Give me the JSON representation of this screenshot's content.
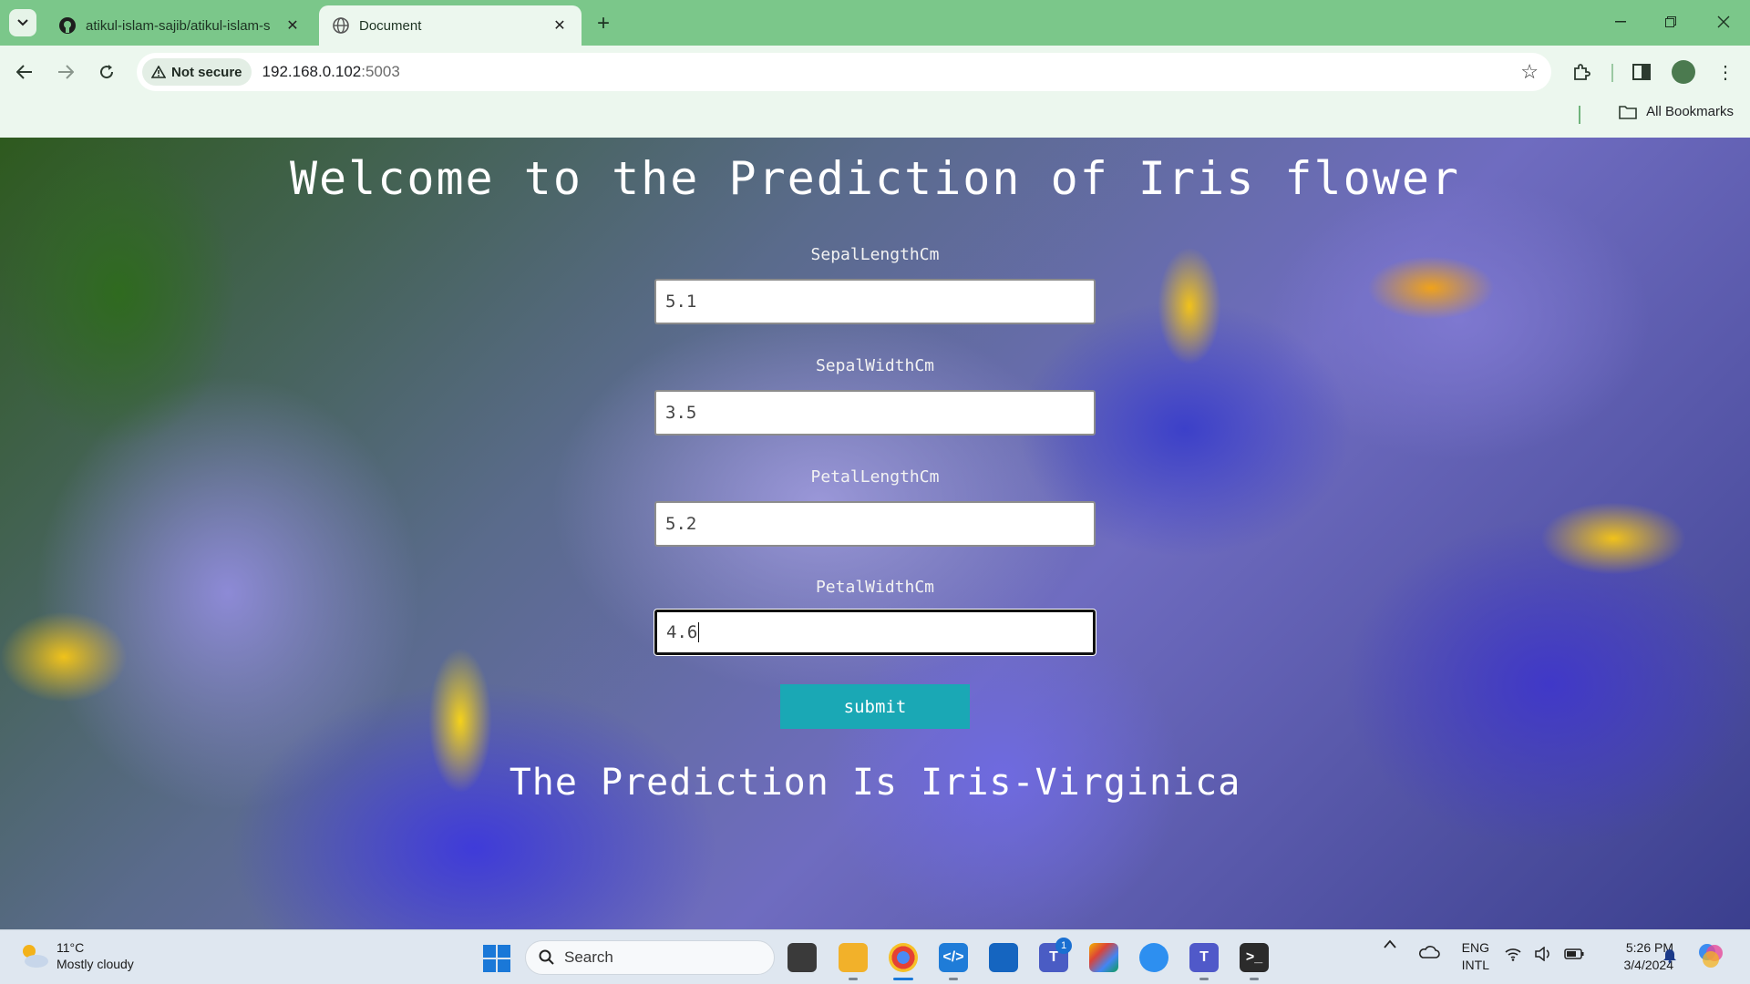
{
  "browser": {
    "tabs": [
      {
        "title": "atikul-islam-sajib/atikul-islam-s",
        "favicon": "github-icon",
        "active": false
      },
      {
        "title": "Document",
        "favicon": "globe-icon",
        "active": true
      }
    ],
    "security_label": "Not secure",
    "url_host": "192.168.0.102",
    "url_port": ":5003",
    "bookmarks_label": "All Bookmarks"
  },
  "page": {
    "title": "Welcome to the Prediction of Iris flower",
    "fields": [
      {
        "label": "SepalLengthCm",
        "value": "5.1"
      },
      {
        "label": "SepalWidthCm",
        "value": "3.5"
      },
      {
        "label": "PetalLengthCm",
        "value": "5.2"
      },
      {
        "label": "PetalWidthCm",
        "value": "4.6"
      }
    ],
    "submit_label": "submit",
    "result": "The Prediction Is Iris-Virginica"
  },
  "taskbar": {
    "weather_temp": "11°C",
    "weather_desc": "Mostly cloudy",
    "search_placeholder": "Search",
    "lang_top": "ENG",
    "lang_bottom": "INTL",
    "time": "5:26 PM",
    "date": "3/4/2024",
    "teams_badge": "1"
  },
  "colors": {
    "tabstrip": "#7bc78a",
    "toolbar": "#ecf7ee",
    "submit": "#1aa8b5"
  }
}
